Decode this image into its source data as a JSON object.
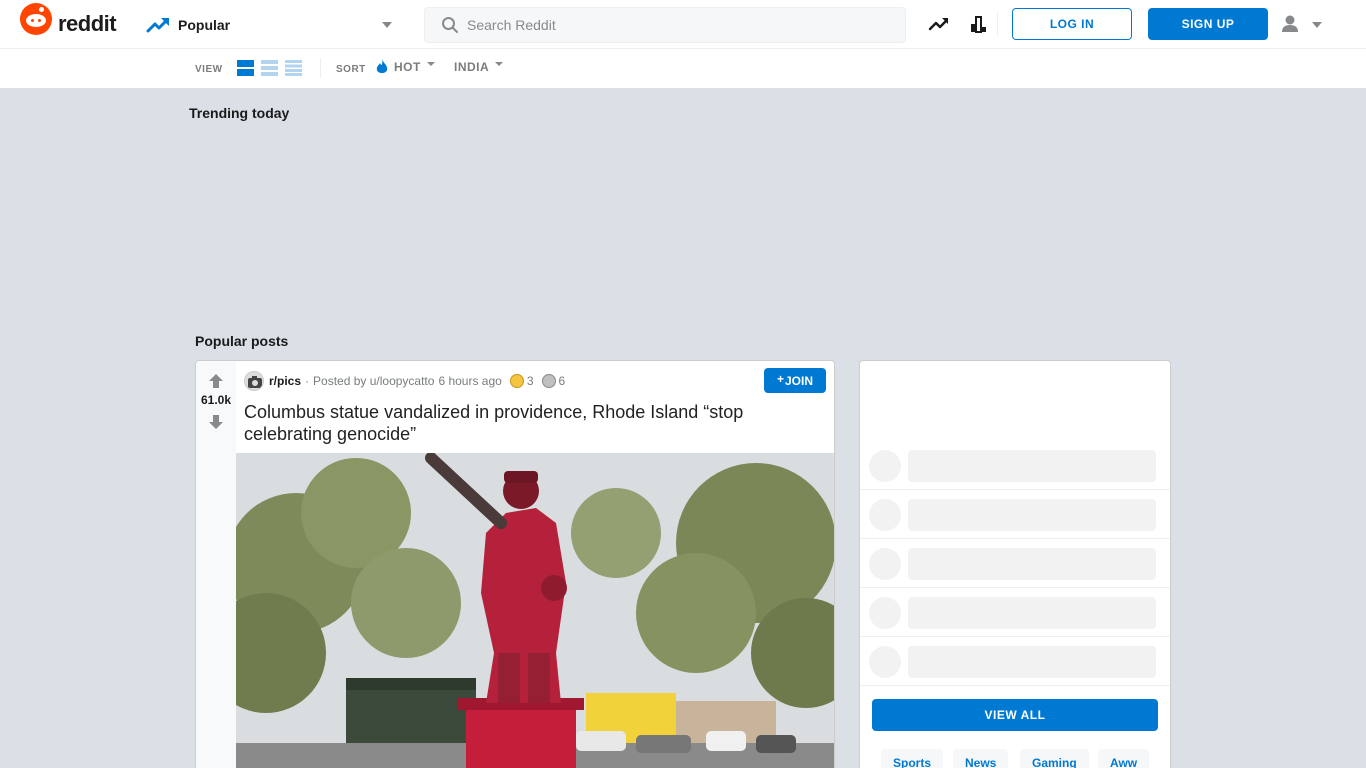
{
  "header": {
    "logo_text": "reddit",
    "feed_label": "Popular",
    "search_placeholder": "Search Reddit",
    "login_label": "LOG IN",
    "signup_label": "SIGN UP"
  },
  "subbar": {
    "view_label": "VIEW",
    "sort_label": "SORT",
    "sort_value": "HOT",
    "location_value": "INDIA"
  },
  "sections": {
    "trending_title": "Trending today",
    "popular_title": "Popular posts"
  },
  "post": {
    "score": "61.0k",
    "subreddit": "r/pics",
    "posted_by": "Posted by u/loopycatto",
    "age": "6 hours ago",
    "award_counts": [
      "3",
      "6"
    ],
    "join_label": "JOIN",
    "title": "Columbus statue vandalized in providence, Rhode Island “stop celebrating genocide”"
  },
  "sidebar": {
    "view_all_label": "VIEW ALL",
    "chips": [
      "Sports",
      "News",
      "Gaming",
      "Aww"
    ]
  },
  "colors": {
    "brand": "#ff4500",
    "accent": "#0079d3",
    "background": "#dae0e6"
  }
}
